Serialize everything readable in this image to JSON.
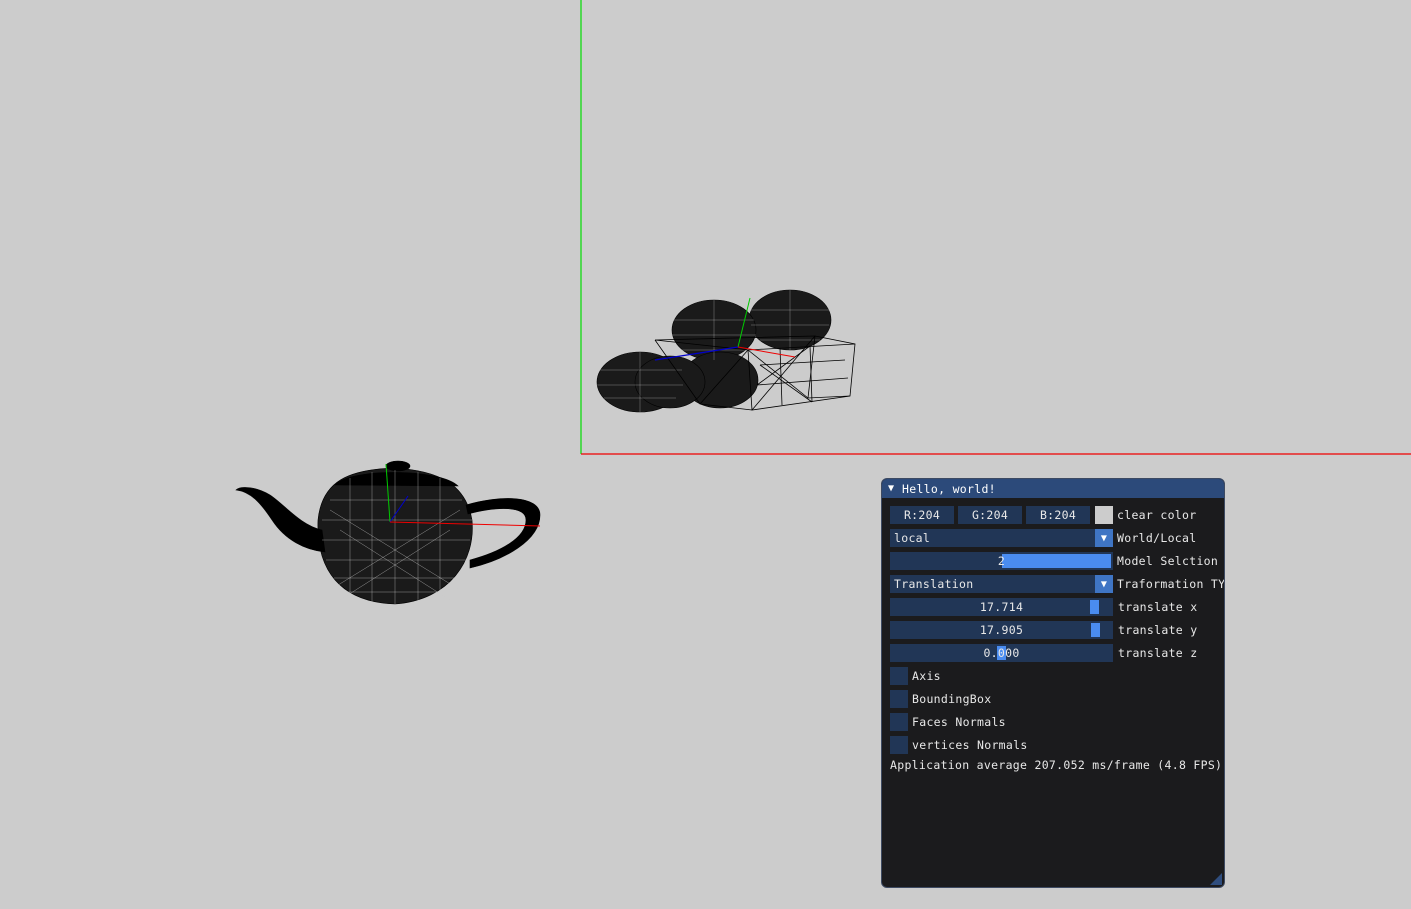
{
  "window": {
    "title": "Hello, world!",
    "collapse_icon": "triangle-down-icon"
  },
  "color": {
    "r": "R:204",
    "g": "G:204",
    "b": "B:204",
    "label": "clear color",
    "swatch": "#cccccc"
  },
  "world_local": {
    "value": "local",
    "label": "World/Local"
  },
  "model_selection": {
    "value": "2",
    "label": "Model Selction"
  },
  "transformation": {
    "value": "Translation",
    "label": "Traformation TY"
  },
  "translate": {
    "x": {
      "value": "17.714",
      "label": "translate x"
    },
    "y": {
      "value": "17.905",
      "label": "translate y"
    },
    "z": {
      "value": "0.000",
      "label": "translate z"
    }
  },
  "checkboxes": {
    "axis": "Axis",
    "bounding_box": "BoundingBox",
    "faces_normals": "Faces Normals",
    "vertices_normals": "vertices Normals"
  },
  "status": "Application average 207.052 ms/frame (4.8 FPS)",
  "colors": {
    "background": "#cccccc",
    "axis_x": "#ff0000",
    "axis_y": "#00cc00",
    "axis_z": "#0000cc",
    "accent": "#4a8cf0"
  }
}
